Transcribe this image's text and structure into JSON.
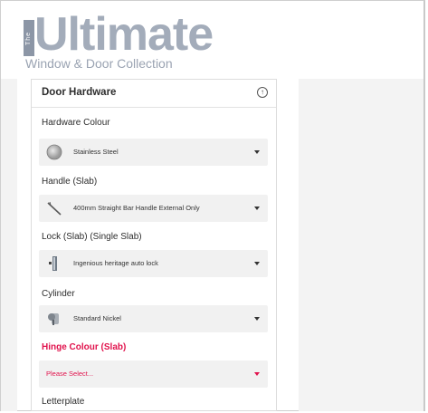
{
  "logo": {
    "the": "The",
    "main": "Ultimate",
    "sub": "Window & Door Collection"
  },
  "panel": {
    "title": "Door Hardware",
    "fields": [
      {
        "label": "Hardware Colour",
        "value": "Stainless Steel",
        "icon": "stainless-swatch-icon"
      },
      {
        "label": "Handle (Slab)",
        "value": "400mm Straight Bar Handle External Only",
        "icon": "bar-handle-icon"
      },
      {
        "label": "Lock (Slab) (Single Slab)",
        "value": "Ingenious heritage auto lock",
        "icon": "lock-icon"
      },
      {
        "label": "Cylinder",
        "value": "Standard Nickel",
        "icon": "cylinder-icon"
      },
      {
        "label": "Hinge Colour (Slab)",
        "value": "Please Select...",
        "error": true
      },
      {
        "label": "Letterplate"
      }
    ]
  },
  "colors": {
    "error": "#e1134d",
    "logo": "#a3acba"
  }
}
